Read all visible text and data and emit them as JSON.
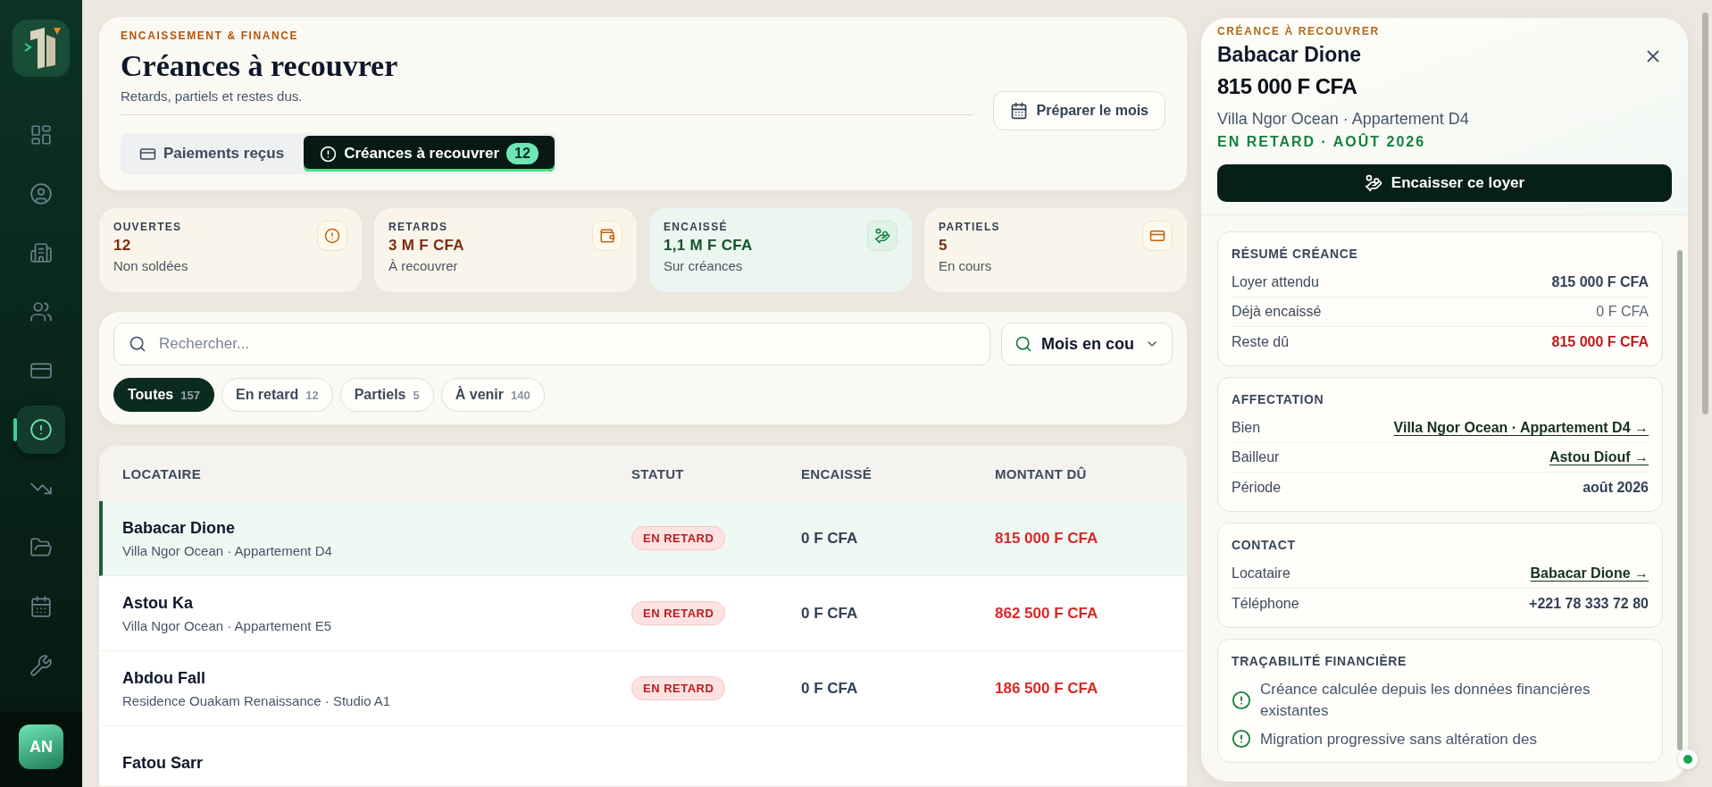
{
  "sidebar": {
    "nav": [
      {
        "selected": false
      },
      {
        "selected": false
      },
      {
        "selected": false
      },
      {
        "selected": false
      },
      {
        "selected": false
      },
      {
        "selected": true
      },
      {
        "selected": false
      },
      {
        "selected": false
      },
      {
        "selected": false
      },
      {
        "selected": false
      }
    ],
    "avatar": "AN"
  },
  "header": {
    "eyebrow": "ENCAISSEMENT & FINANCE",
    "title": "Créances à recouvrer",
    "subtitle": "Retards, partiels et restes dus.",
    "action": "Préparer le mois",
    "tabs": [
      {
        "label": "Paiements reçus",
        "selected": false
      },
      {
        "label": "Créances à recouvrer",
        "selected": true,
        "count": "12"
      }
    ]
  },
  "kpis": [
    {
      "label": "OUVERTES",
      "value": "12",
      "sub": "Non soldées",
      "kind": "warn"
    },
    {
      "label": "RETARDS",
      "value": "3 M F CFA",
      "sub": "À recouvrer",
      "kind": "warn"
    },
    {
      "label": "ENCAISSÉ",
      "value": "1,1 M F CFA",
      "sub": "Sur créances",
      "kind": "success"
    },
    {
      "label": "PARTIELS",
      "value": "5",
      "sub": "En cours",
      "kind": "warn"
    }
  ],
  "filters": {
    "search": {
      "placeholder": "Rechercher..."
    },
    "period": "Mois en cou",
    "chips": [
      {
        "label": "Toutes",
        "count": "157",
        "selected": true
      },
      {
        "label": "En retard",
        "count": "12",
        "selected": false
      },
      {
        "label": "Partiels",
        "count": "5",
        "selected": false
      },
      {
        "label": "À venir",
        "count": "140",
        "selected": false
      }
    ]
  },
  "table": {
    "columns": [
      "LOCATAIRE",
      "STATUT",
      "ENCAISSÉ",
      "MONTANT DÛ"
    ],
    "rows": [
      {
        "name": "Babacar Dione",
        "sub": "Villa Ngor Ocean · Appartement D4",
        "status": "EN RETARD",
        "collected": "0 F CFA",
        "due": "815 000 F CFA",
        "selected": true
      },
      {
        "name": "Astou Ka",
        "sub": "Villa Ngor Ocean · Appartement E5",
        "status": "EN RETARD",
        "collected": "0 F CFA",
        "due": "862 500 F CFA",
        "selected": false
      },
      {
        "name": "Abdou Fall",
        "sub": "Residence Ouakam Renaissance · Studio A1",
        "status": "EN RETARD",
        "collected": "0 F CFA",
        "due": "186 500 F CFA",
        "selected": false
      },
      {
        "name": "Fatou Sarr",
        "selected": false
      }
    ]
  },
  "panel": {
    "eyebrow": "CRÉANCE À RECOUVRER",
    "name": "Babacar Dione",
    "amount": "815 000 F CFA",
    "property": "Villa Ngor Ocean · Appartement D4",
    "status": "EN RETARD · AOÛT 2026",
    "action": "Encaisser ce loyer",
    "sections": [
      {
        "title": "RÉSUMÉ CRÉANCE",
        "rows": [
          {
            "label": "Loyer attendu",
            "value": "815 000 F CFA",
            "kind": "plain"
          },
          {
            "label": "Déjà encaissé",
            "value": "0 F CFA",
            "kind": "muted"
          },
          {
            "label": "Reste dû",
            "value": "815 000 F CFA",
            "kind": "danger"
          }
        ]
      },
      {
        "title": "AFFECTATION",
        "rows": [
          {
            "label": "Bien",
            "value": "Villa Ngor Ocean · Appartement D4 →",
            "kind": "link"
          },
          {
            "label": "Bailleur",
            "value": "Astou Diouf →",
            "kind": "link"
          },
          {
            "label": "Période",
            "value": "août 2026",
            "kind": "plain"
          }
        ]
      },
      {
        "title": "CONTACT",
        "rows": [
          {
            "label": "Locataire",
            "value": "Babacar Dione →",
            "kind": "link"
          },
          {
            "label": "Téléphone",
            "value": "+221 78 333 72 80",
            "kind": "plain"
          }
        ]
      },
      {
        "title": "TRAÇABILITÉ FINANCIÈRE",
        "notes": [
          "Créance calculée depuis les données financières existantes",
          "Migration progressive sans altération des"
        ]
      }
    ]
  }
}
